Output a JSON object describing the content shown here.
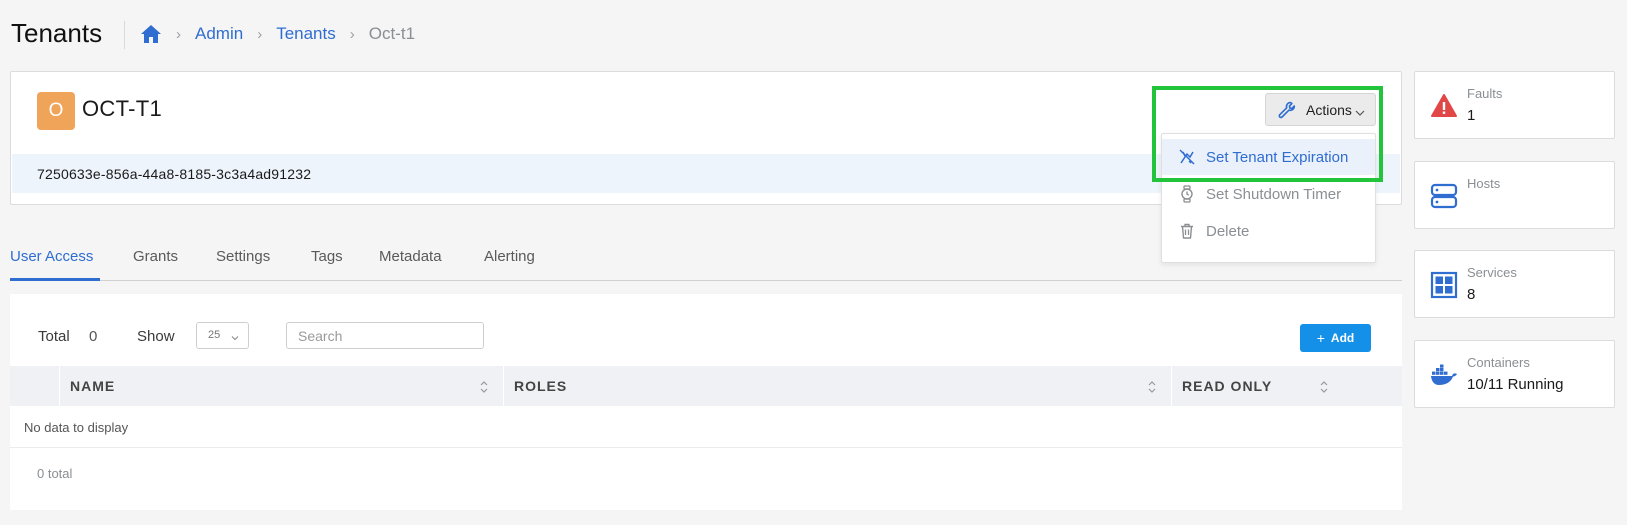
{
  "header": {
    "title": "Tenants",
    "breadcrumb": {
      "admin": "Admin",
      "tenants": "Tenants",
      "current": "Oct-t1"
    }
  },
  "tenant": {
    "avatar_letter": "O",
    "name": "OCT-T1",
    "uuid": "7250633e-856a-44a8-8185-3c3a4ad91232"
  },
  "actions": {
    "label": "Actions",
    "menu": [
      {
        "label": "Set Tenant Expiration",
        "icon": "no-clock-icon"
      },
      {
        "label": "Set Shutdown Timer",
        "icon": "watch-icon"
      },
      {
        "label": "Delete",
        "icon": "trash-icon"
      }
    ]
  },
  "tabs": [
    "User Access",
    "Grants",
    "Settings",
    "Tags",
    "Metadata",
    "Alerting"
  ],
  "table": {
    "total_label": "Total",
    "total_value": "0",
    "show_label": "Show",
    "show_value": "25",
    "search_placeholder": "Search",
    "add_label": "Add",
    "columns": [
      "NAME",
      "ROLES",
      "READ ONLY"
    ],
    "empty_text": "No data to display",
    "footer": "0 total"
  },
  "stats": [
    {
      "label": "Faults",
      "value": "1",
      "icon": "warning-icon"
    },
    {
      "label": "Hosts",
      "value": "",
      "icon": "server-icon"
    },
    {
      "label": "Services",
      "value": "8",
      "icon": "grid-icon"
    },
    {
      "label": "Containers",
      "value": "10/11 Running",
      "icon": "docker-icon"
    }
  ],
  "colors": {
    "accent": "#2f6dd1",
    "add_button": "#1590e8",
    "avatar": "#f0a45a",
    "highlight": "#22c43c",
    "fault": "#e14747"
  }
}
